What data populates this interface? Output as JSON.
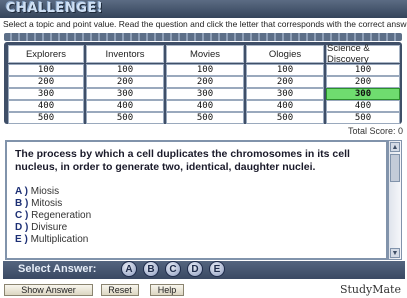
{
  "header": {
    "logo": "CHALLENGE!",
    "instruction": "Select a topic and point value. Read the question and click the letter that corresponds with the correct answer."
  },
  "board": {
    "categories": [
      "Explorers",
      "Inventors",
      "Movies",
      "Ologies",
      "Science & Discovery"
    ],
    "rows": [
      [
        "100",
        "100",
        "100",
        "100",
        "100"
      ],
      [
        "200",
        "200",
        "200",
        "200",
        "200"
      ],
      [
        "300",
        "300",
        "300",
        "300",
        "300"
      ],
      [
        "400",
        "400",
        "400",
        "400",
        "400"
      ],
      [
        "500",
        "500",
        "500",
        "500",
        "500"
      ]
    ],
    "selected_color": "#6fdc6f"
  },
  "score": {
    "label": "Total Score: 0"
  },
  "question": {
    "text": "The process by which a cell duplicates the chromosomes in its cell nucleus, in order to generate two, identical, daughter nuclei.",
    "answers": [
      {
        "letter": "A )",
        "text": "Miosis"
      },
      {
        "letter": "B )",
        "text": "Mitosis"
      },
      {
        "letter": "C )",
        "text": "Regeneration"
      },
      {
        "letter": "D )",
        "text": "Divisure"
      },
      {
        "letter": "E )",
        "text": "Multiplication"
      }
    ]
  },
  "select": {
    "label": "Select Answer:",
    "letters": [
      "A",
      "B",
      "C",
      "D",
      "E"
    ]
  },
  "buttons": {
    "show_answer": "Show Answer",
    "reset": "Reset",
    "help": "Help"
  },
  "brand": "StudyMate",
  "icons": {
    "scroll_up": "scroll-up-arrow-icon",
    "scroll_down": "scroll-down-arrow-icon"
  }
}
